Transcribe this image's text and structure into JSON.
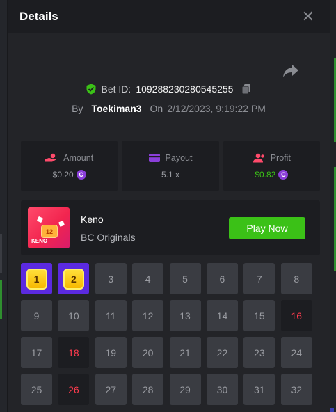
{
  "modal": {
    "title": "Details",
    "close_icon": "close-icon"
  },
  "bet": {
    "id_label": "Bet ID:",
    "id_value": "109288230280545255",
    "by_label": "By",
    "username": "Toekiman3",
    "on_label": "On",
    "date": "2/12/2023, 9:19:22 PM"
  },
  "stats": {
    "amount": {
      "label": "Amount",
      "value": "$0.20",
      "icon": "hand-coins-icon"
    },
    "payout": {
      "label": "Payout",
      "value": "5.1 x",
      "icon": "card-icon"
    },
    "profit": {
      "label": "Profit",
      "value": "$0.82",
      "icon": "user-profit-icon"
    }
  },
  "game": {
    "name": "Keno",
    "provider": "BC Originals",
    "thumb_label": "KENO",
    "thumb_ball": "12",
    "play_label": "Play Now"
  },
  "grid": {
    "cells": [
      {
        "n": "1",
        "state": "hit"
      },
      {
        "n": "2",
        "state": "hit"
      },
      {
        "n": "3",
        "state": "normal"
      },
      {
        "n": "4",
        "state": "normal"
      },
      {
        "n": "5",
        "state": "normal"
      },
      {
        "n": "6",
        "state": "normal"
      },
      {
        "n": "7",
        "state": "normal"
      },
      {
        "n": "8",
        "state": "normal"
      },
      {
        "n": "9",
        "state": "normal"
      },
      {
        "n": "10",
        "state": "normal"
      },
      {
        "n": "11",
        "state": "normal"
      },
      {
        "n": "12",
        "state": "normal"
      },
      {
        "n": "13",
        "state": "normal"
      },
      {
        "n": "14",
        "state": "normal"
      },
      {
        "n": "15",
        "state": "normal"
      },
      {
        "n": "16",
        "state": "selected"
      },
      {
        "n": "17",
        "state": "normal"
      },
      {
        "n": "18",
        "state": "selected"
      },
      {
        "n": "19",
        "state": "normal"
      },
      {
        "n": "20",
        "state": "normal"
      },
      {
        "n": "21",
        "state": "normal"
      },
      {
        "n": "22",
        "state": "normal"
      },
      {
        "n": "23",
        "state": "normal"
      },
      {
        "n": "24",
        "state": "normal"
      },
      {
        "n": "25",
        "state": "normal"
      },
      {
        "n": "26",
        "state": "selected"
      },
      {
        "n": "27",
        "state": "normal"
      },
      {
        "n": "28",
        "state": "normal"
      },
      {
        "n": "29",
        "state": "normal"
      },
      {
        "n": "30",
        "state": "normal"
      },
      {
        "n": "31",
        "state": "normal"
      },
      {
        "n": "32",
        "state": "normal"
      }
    ]
  },
  "colors": {
    "accent_green": "#3bc117",
    "selected_red": "#ff3b4e",
    "hit_purple": "#5b2ae0",
    "coin_purple": "#8b3fd9"
  }
}
